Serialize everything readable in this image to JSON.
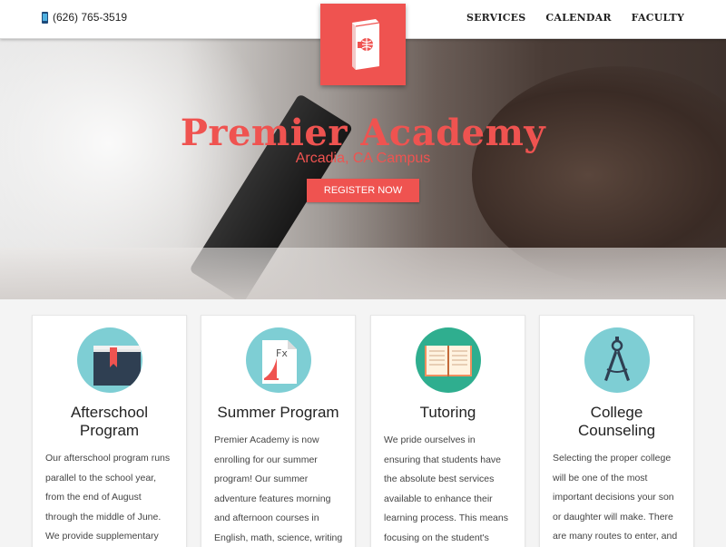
{
  "header": {
    "phone": "(626) 765-3519",
    "phone_icon": "phone-icon",
    "nav": [
      "SERVICES",
      "CALENDAR",
      "FACULTY"
    ],
    "logo_icon": "book-globe-icon"
  },
  "hero": {
    "title": "Premier Academy",
    "subtitle": "Arcadia, CA Campus",
    "cta": "REGISTER NOW"
  },
  "cards": [
    {
      "icon": "book-icon",
      "title_line1": "Afterschool",
      "title_line2": "Program",
      "text": "Our afterschool program runs parallel to the school year, from the end of August through the middle of June. We provide supplementary"
    },
    {
      "icon": "document-fx-icon",
      "title_line1": "Summer Program",
      "title_line2": "",
      "text": "Premier Academy is now enrolling for our summer program! Our summer adventure features morning and afternoon courses in English, math, science, writing"
    },
    {
      "icon": "open-book-icon",
      "title_line1": "Tutoring",
      "title_line2": "",
      "text": "We pride ourselves in ensuring that students have the absolute best services available to enhance their learning process. This means focusing on the student's"
    },
    {
      "icon": "compass-icon",
      "title_line1": "College",
      "title_line2": "Counseling",
      "text": "Selecting the proper college will be one of the most important decisions your son or daughter will make. There are many routes to enter, and"
    }
  ],
  "colors": {
    "accent": "#ef5350",
    "nav_text": "#222222"
  }
}
